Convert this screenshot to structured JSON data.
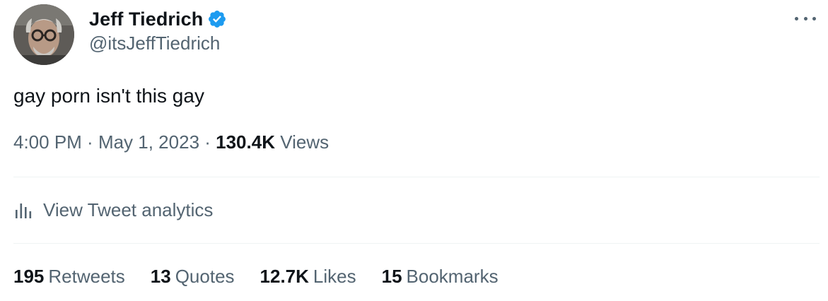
{
  "author": {
    "display_name": "Jeff Tiedrich",
    "handle": "@itsJeffTiedrich",
    "verified_icon": "verified-badge-icon",
    "verified_color": "#1d9bf0"
  },
  "tweet": {
    "text": "gay porn isn't this gay",
    "time": "4:00 PM",
    "sep1": " · ",
    "date": "May 1, 2023",
    "sep2": " · ",
    "views_count": "130.4K",
    "views_label": "Views"
  },
  "analytics": {
    "icon": "bar-chart-icon",
    "label": "View Tweet analytics"
  },
  "stats": [
    {
      "count": "195",
      "label": "Retweets"
    },
    {
      "count": "13",
      "label": "Quotes"
    },
    {
      "count": "12.7K",
      "label": "Likes"
    },
    {
      "count": "15",
      "label": "Bookmarks"
    }
  ],
  "colors": {
    "text_primary": "#0f1419",
    "text_secondary": "#536471",
    "divider": "#eff3f4"
  }
}
